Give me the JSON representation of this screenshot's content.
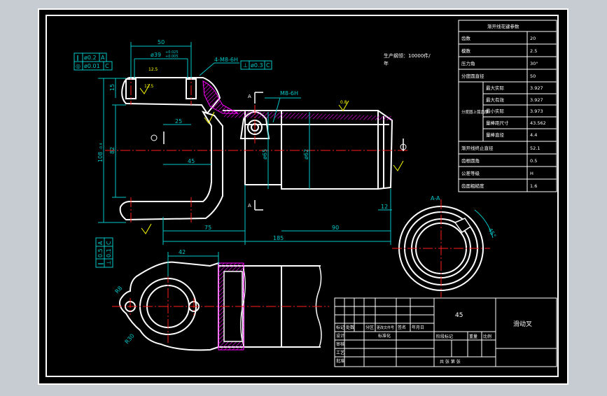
{
  "colors": {
    "background": "#c7ccd3",
    "sheet": "#000000",
    "outline": "#ffffff",
    "dimension": "#00c8c8",
    "centerline": "#ff2020",
    "hatch": "#ff00ff",
    "annotation": "#ffff00"
  },
  "dims": {
    "d50": "50",
    "d39": "ø39",
    "d39tol_up": "+0.025",
    "d39tol_lo": "+0.005",
    "m8_6h": "4-M8-6H",
    "d15": "15",
    "d25": "25",
    "d108": "108",
    "d108tol": "-0.4",
    "d82": "82",
    "d45": "45",
    "d75": "75",
    "d90": "90",
    "d185": "185",
    "d12": "12",
    "d65": "ø65",
    "d62": "ø62",
    "m8_6h_b": "M8-6H",
    "d42": "42",
    "r8": "R8",
    "r30": "R30",
    "ang45": "45°",
    "section": "A-A",
    "mark_a": "A",
    "ra12": "12.5",
    "ra08": "0.8"
  },
  "gdt": {
    "a_sym": "∥",
    "a_val": "ø0.2",
    "a_ref": "A",
    "b_sym": "◎",
    "b_val": "ø0.01",
    "b_ref": "C",
    "c_sym": "⊥",
    "c_val": "ø0.3",
    "c_ref": "C",
    "d_sym": "∥",
    "d_val": "0.5",
    "d_ref": "A",
    "e_sym": "⊥",
    "e_val": "0.1",
    "e_ref": "C"
  },
  "note": {
    "line1": "生产纲领：10000件/",
    "line2": "年"
  },
  "param_table": {
    "title": "渐开线花键参数",
    "rows": [
      {
        "label": "齿数",
        "value": "20"
      },
      {
        "label": "模数",
        "value": "2.5"
      },
      {
        "label": "压力角",
        "value": "30°"
      },
      {
        "label": "分度圆直径",
        "value": "50"
      }
    ],
    "group_label": "分度圆上弧齿厚",
    "sub_rows": [
      {
        "label": "最大实际",
        "value": "3.927"
      },
      {
        "label": "最大有效",
        "value": "3.927"
      },
      {
        "label": "最小实际",
        "value": "3.973"
      },
      {
        "label": "量棒距尺寸",
        "value": "43.562"
      },
      {
        "label": "量棒直径",
        "value": "4.4"
      }
    ],
    "rows_bottom": [
      {
        "label": "渐开线终止直径",
        "value": "52.1"
      },
      {
        "label": "齿根圆角",
        "value": "0.5"
      },
      {
        "label": "公差等级",
        "value": "H"
      },
      {
        "label": "齿面粗糙度",
        "value": "1.6"
      }
    ]
  },
  "title_block": {
    "material": "45",
    "part_name": "滑动叉",
    "r_mark": "标记",
    "r_count": "处数",
    "r_zone": "分区",
    "r_doc": "更改文件号",
    "r_sign": "签名",
    "r_date": "年月日",
    "r_design": "设计",
    "r_std": "标准化",
    "r_check": "审核",
    "r_craft": "工艺",
    "r_approve": "批准",
    "r_stage": "阶段标记",
    "r_weight": "重量",
    "r_scale": "比例",
    "r_sheet": "共 张 第 张"
  }
}
